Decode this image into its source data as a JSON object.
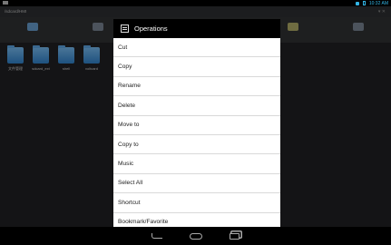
{
  "status_bar": {
    "time": "10:32 AM"
  },
  "app": {
    "path": "/sdcard/HMI",
    "files": [
      {
        "name": "文件管理"
      },
      {
        "name": "sdcard_ext"
      },
      {
        "name": "shell"
      },
      {
        "name": "voltcard"
      }
    ]
  },
  "dialog": {
    "title": "Operations",
    "items": [
      {
        "label": "Cut"
      },
      {
        "label": "Copy"
      },
      {
        "label": "Rename"
      },
      {
        "label": "Delete"
      },
      {
        "label": "Move to"
      },
      {
        "label": "Copy to"
      },
      {
        "label": "Music"
      },
      {
        "label": "Select All"
      },
      {
        "label": "Shortcut"
      },
      {
        "label": "Bookmark/Favorite"
      }
    ]
  }
}
